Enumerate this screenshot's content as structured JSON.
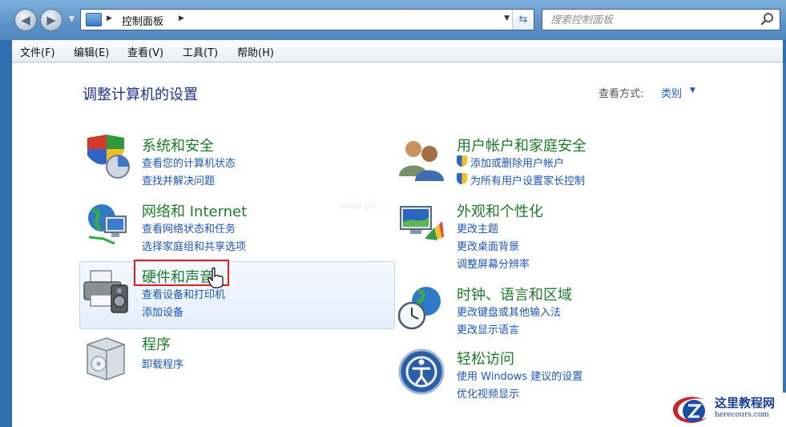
{
  "address_bar": {
    "path": "控制面板",
    "search_placeholder": "搜索控制面板"
  },
  "menu": [
    {
      "label": "文件(F)"
    },
    {
      "label": "编辑(E)"
    },
    {
      "label": "查看(V)"
    },
    {
      "label": "工具(T)"
    },
    {
      "label": "帮助(H)"
    }
  ],
  "main": {
    "title": "调整计算机的设置",
    "view_by_label": "查看方式:",
    "view_by_value": "类别"
  },
  "categories": {
    "system_security": {
      "title": "系统和安全",
      "links": [
        "查看您的计算机状态",
        "查找并解决问题"
      ],
      "icon": "shield-chart-icon"
    },
    "network": {
      "title": "网络和 Internet",
      "links": [
        "查看网络状态和任务",
        "选择家庭组和共享选项"
      ],
      "icon": "network-globe-icon"
    },
    "hardware_sound": {
      "title": "硬件和声音",
      "links": [
        "查看设备和打印机",
        "添加设备"
      ],
      "icon": "printer-speaker-icon",
      "highlighted": true
    },
    "programs": {
      "title": "程序",
      "links": [
        "卸载程序"
      ],
      "icon": "programs-box-icon"
    },
    "user_accounts": {
      "title": "用户帐户和家庭安全",
      "links": [
        "添加或删除用户帐户",
        "为所有用户设置家长控制"
      ],
      "icon": "users-icon"
    },
    "appearance": {
      "title": "外观和个性化",
      "links": [
        "更改主题",
        "更改桌面背景",
        "调整屏幕分辨率"
      ],
      "icon": "monitor-palette-icon"
    },
    "clock_region": {
      "title": "时钟、语言和区域",
      "links": [
        "更改键盘或其他输入法",
        "更改显示语言"
      ],
      "icon": "clock-globe-icon"
    },
    "ease_access": {
      "title": "轻松访问",
      "links": [
        "使用 Windows 建议的设置",
        "优化视频显示"
      ],
      "icon": "ease-of-access-icon"
    }
  },
  "watermark": "www.ph...",
  "logo": {
    "title": "这里教程网",
    "url_text": "herecours.com"
  },
  "colors": {
    "category_title": "#1f7a2a",
    "link": "#1c56b8",
    "page_title": "#1e3287",
    "highlight_border": "#e02020"
  }
}
